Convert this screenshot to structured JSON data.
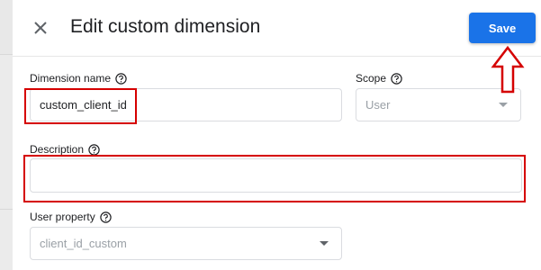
{
  "dialog": {
    "title": "Edit custom dimension",
    "save_label": "Save"
  },
  "form": {
    "dimension_name": {
      "label": "Dimension name",
      "value": "custom_client_id"
    },
    "scope": {
      "label": "Scope",
      "value": "User"
    },
    "description": {
      "label": "Description",
      "value": ""
    },
    "user_property": {
      "label": "User property",
      "value": "client_id_custom"
    }
  },
  "icons": {
    "close": "close-icon",
    "help": "help-circle-icon",
    "dropdown": "chevron-down-icon",
    "annotation_arrow": "up-arrow-icon"
  },
  "colors": {
    "accent": "#1a73e8",
    "highlight": "#d50000",
    "text": "#202124",
    "muted": "#9aa0a6"
  }
}
